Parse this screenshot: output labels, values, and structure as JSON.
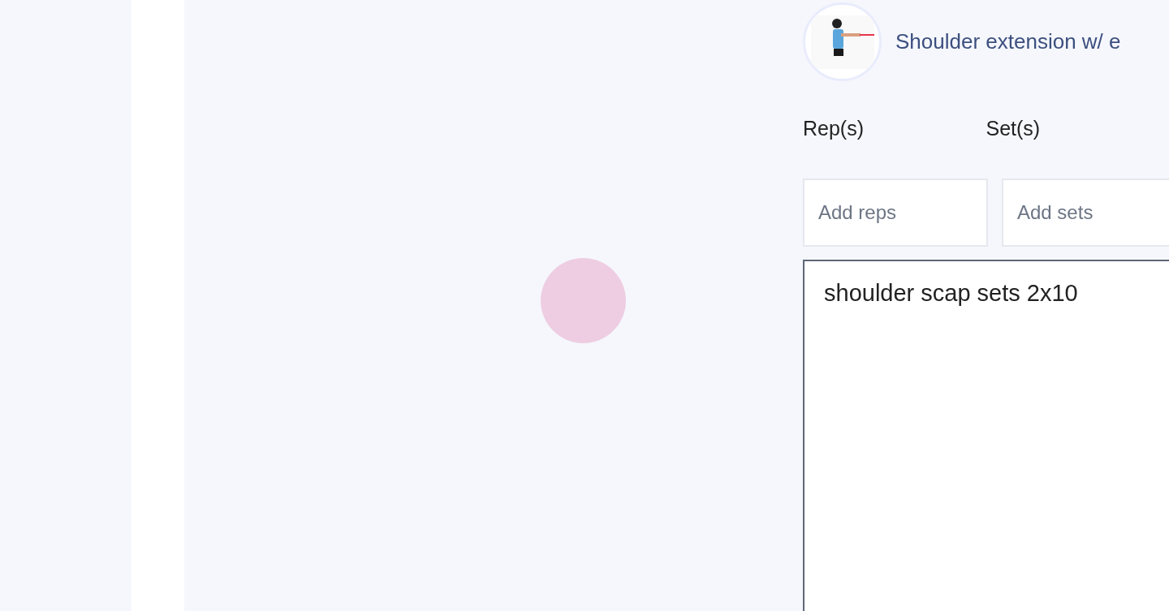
{
  "exercise": {
    "title": "Shoulder extension w/ e"
  },
  "fields": [
    {
      "label": "Rep(s)",
      "placeholder": "Add reps"
    },
    {
      "label": "Set(s)",
      "placeholder": "Add sets"
    }
  ],
  "notes": {
    "value": "shoulder scap sets 2x10"
  }
}
